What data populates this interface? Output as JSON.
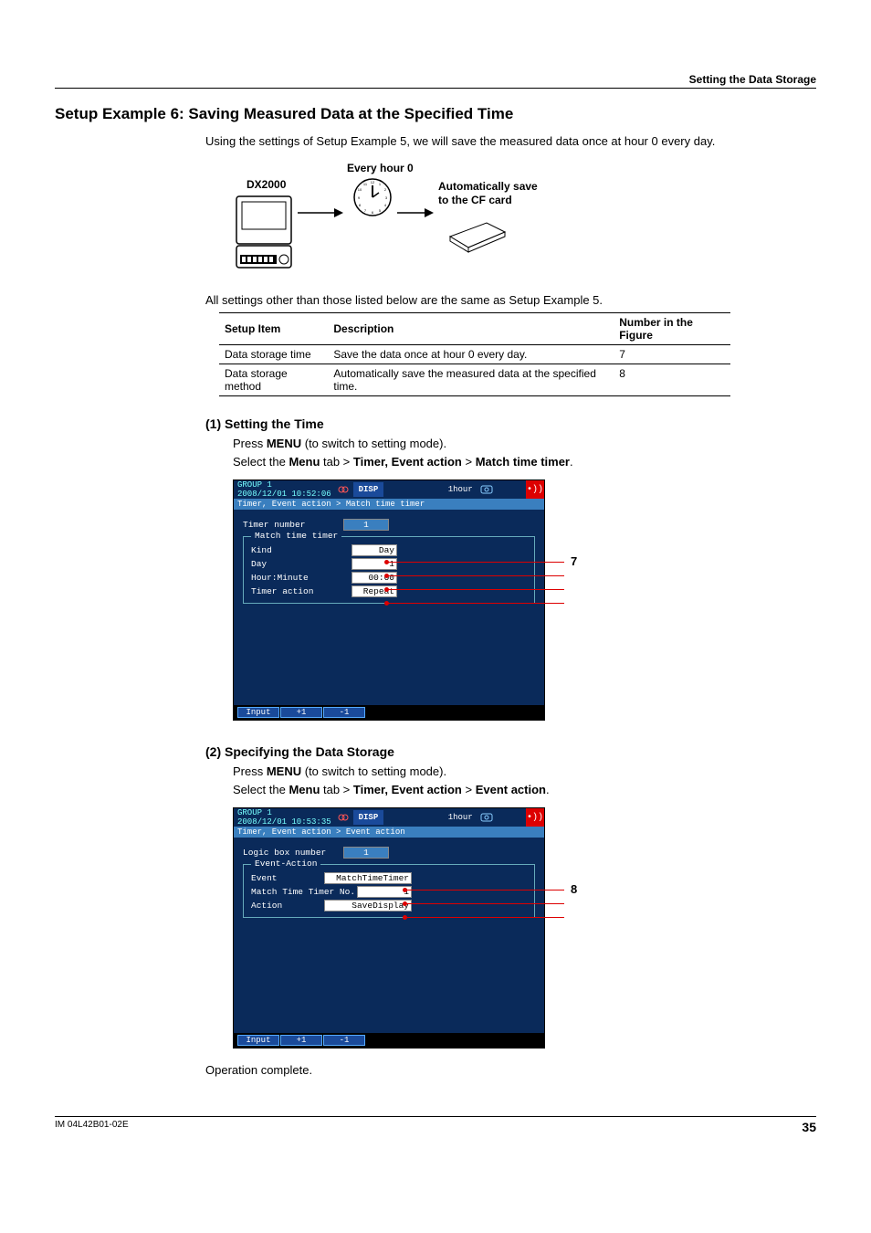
{
  "header": {
    "section_title": "Setting the Data Storage"
  },
  "title": "Setup Example 6: Saving Measured Data at the Specified Time",
  "intro": "Using the settings of Setup Example 5, we will save the measured data once at hour 0 every day.",
  "figure": {
    "device_label": "DX2000",
    "clock_label": "Every hour 0",
    "auto_save_line1": "Automatically save",
    "auto_save_line2": "to the CF card"
  },
  "pre_table_text": "All settings other than those listed below are the same as Setup Example 5.",
  "table": {
    "headers": {
      "c1": "Setup Item",
      "c2": "Description",
      "c3": "Number in the Figure"
    },
    "rows": [
      {
        "c1": "Data storage time",
        "c2": "Save the data once at hour 0 every day.",
        "c3": "7"
      },
      {
        "c1": "Data storage method",
        "c2": "Automatically save the measured data at the specified time.",
        "c3": "8"
      }
    ]
  },
  "sec1": {
    "heading": "(1) Setting the Time",
    "line1_pre": "Press ",
    "line1_bold": "MENU",
    "line1_post": " (to switch to setting mode).",
    "line2_pre": "Select the ",
    "line2_b1": "Menu",
    "line2_mid1": " tab > ",
    "line2_b2": "Timer, Event action",
    "line2_mid2": " > ",
    "line2_b3": "Match time timer",
    "line2_end": ".",
    "callout": "7"
  },
  "screen1": {
    "group": "GROUP 1",
    "date": "2008/12/01 10:52:06",
    "disp": "DISP",
    "hour": "1hour",
    "breadcrumb": "Timer, Event action > Match time timer",
    "field_timer_number_label": "Timer number",
    "field_timer_number_value": "1",
    "group_title": "Match time timer",
    "kind_label": "Kind",
    "kind_value": "Day",
    "day_label": "Day",
    "day_value": "1",
    "hm_label": "Hour:Minute",
    "hm_value": "00:00",
    "action_label": "Timer action",
    "action_value": "Repeat",
    "footer_input": "Input",
    "footer_plus": "+1",
    "footer_minus": "-1"
  },
  "sec2": {
    "heading": "(2) Specifying the Data Storage",
    "line1_pre": "Press ",
    "line1_bold": "MENU",
    "line1_post": " (to switch to setting mode).",
    "line2_pre": "Select the ",
    "line2_b1": "Menu",
    "line2_mid1": " tab > ",
    "line2_b2": "Timer, Event action",
    "line2_mid2": " > ",
    "line2_b3": "Event action",
    "line2_end": ".",
    "callout": "8"
  },
  "screen2": {
    "group": "GROUP 1",
    "date": "2008/12/01 10:53:35",
    "disp": "DISP",
    "hour": "1hour",
    "breadcrumb": "Timer, Event action > Event action",
    "logic_label": "Logic box number",
    "logic_value": "1",
    "group_title": "Event-Action",
    "event_label": "Event",
    "event_value": "MatchTimeTimer",
    "mt_label": "Match Time Timer No.",
    "mt_value": "1",
    "action_label": "Action",
    "action_value": "SaveDisplay",
    "footer_input": "Input",
    "footer_plus": "+1",
    "footer_minus": "-1"
  },
  "closing": "Operation complete.",
  "footer": {
    "doc_id": "IM 04L42B01-02E",
    "page": "35"
  }
}
